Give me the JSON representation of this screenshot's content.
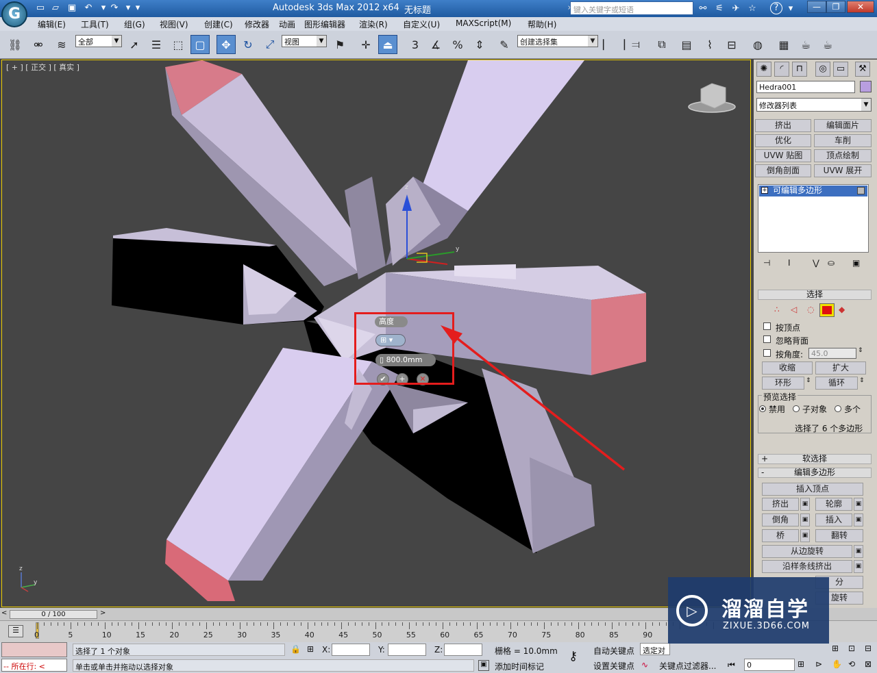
{
  "titlebar": {
    "app_title": "Autodesk 3ds Max  2012 x64",
    "doc_title": "无标题",
    "search_placeholder": "键入关键字或短语",
    "help_icon": "?"
  },
  "menus": [
    "编辑(E)",
    "工具(T)",
    "组(G)",
    "视图(V)",
    "创建(C)",
    "修改器",
    "动画",
    "图形编辑器",
    "渲染(R)",
    "自定义(U)",
    "MAXScript(M)",
    "帮助(H)"
  ],
  "toolbar": {
    "filter_value": "全部",
    "refcoord_value": "视图",
    "selection_set_placeholder": "创建选择集",
    "snap_label": "3",
    "percent_label": "%"
  },
  "viewport": {
    "label": "[ + ] [ 正交 ] [ 真实 ]"
  },
  "caddy": {
    "title": "高度",
    "value": "800.0mm"
  },
  "command_panel": {
    "object_name": "Hedra001",
    "object_color": "#b89ee0",
    "modifier_list": "修改器列表",
    "modifier_buttons": [
      "挤出",
      "编辑面片",
      "优化",
      "车削",
      "UVW 贴图",
      "顶点绘制",
      "倒角剖面",
      "UVW 展开"
    ],
    "stack_item": "可编辑多边形",
    "selection_rollout": "选择",
    "by_vertex": "按顶点",
    "ignore_backfacing": "忽略背面",
    "by_angle": "按角度:",
    "angle_value": "45.0",
    "shrink": "收缩",
    "grow": "扩大",
    "ring": "环形",
    "loop": "循环",
    "preview_label": "预览选择",
    "preview_options": [
      "禁用",
      "子对象",
      "多个"
    ],
    "selection_status": "选择了 6 个多边形",
    "soft_selection": "软选择",
    "edit_polygons": "编辑多边形",
    "insert_vertex": "插入顶点",
    "extrude": "挤出",
    "outline": "轮廓",
    "bevel": "倒角",
    "inset": "插入",
    "bridge": "桥",
    "flip": "翻转",
    "hinge_from_edge": "从边旋转",
    "extrude_along_spline": "沿样条线挤出",
    "partial_label": "分",
    "rotate_label": "旋转"
  },
  "timeline": {
    "slider_value": "0 / 100",
    "ticks": [
      "0",
      "5",
      "10",
      "15",
      "20",
      "25",
      "30",
      "35",
      "40",
      "45",
      "50",
      "55",
      "60",
      "65",
      "70",
      "75",
      "80",
      "85",
      "90"
    ]
  },
  "status": {
    "selected_objects": "选择了 1 个对象",
    "prompt": "单击或单击并拖动以选择对象",
    "maxscript_label": "所在行:",
    "x_label": "X:",
    "y_label": "Y:",
    "z_label": "Z:",
    "grid": "栅格 = 10.0mm",
    "add_time_tag": "添加时间标记",
    "auto_key": "自动关键点",
    "set_key": "设置关键点",
    "selected_dropdown": "选定对",
    "key_filters": "关键点过滤器...",
    "frame_value": "0"
  },
  "watermark": {
    "title": "溜溜自学",
    "subtitle": "ZIXUE.3D66.COM"
  }
}
